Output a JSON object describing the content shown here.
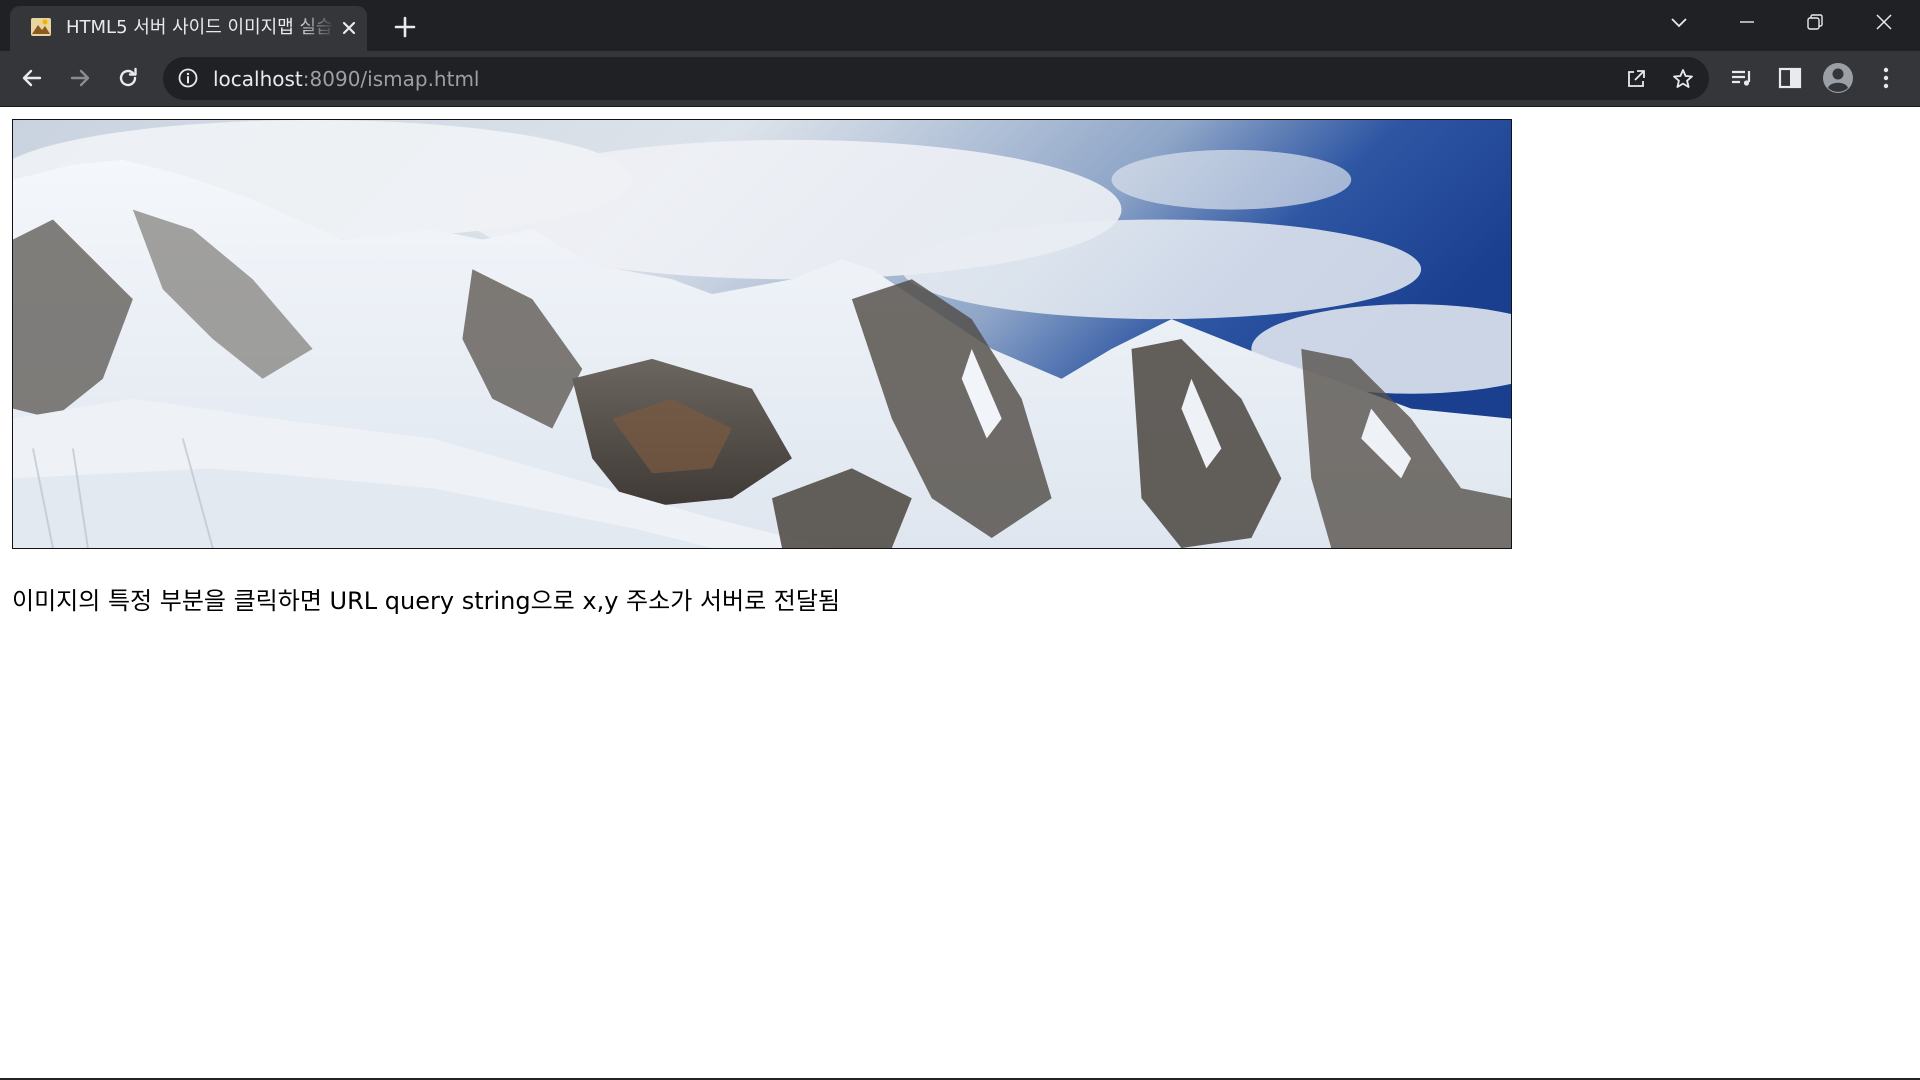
{
  "browser": {
    "tab": {
      "title": "HTML5 서버 사이드 이미지맵 실습",
      "favicon": "image-favicon"
    },
    "new_tab_icon": "plus-icon",
    "window_controls": [
      "tab-search-icon",
      "minimize-icon",
      "restore-icon",
      "close-icon"
    ],
    "toolbar": {
      "back_icon": "arrow-left-icon",
      "forward_icon": "arrow-right-icon",
      "reload_icon": "reload-icon",
      "url_host": "localhost",
      "url_rest": ":8090/ismap.html",
      "right_icons": [
        "share-icon",
        "star-icon",
        "media-queue-icon",
        "side-panel-icon",
        "profile-avatar-icon",
        "kebab-menu-icon"
      ]
    },
    "colors": {
      "tabstrip_bg": "#202124",
      "toolbar_bg": "#35363a",
      "omnibox_bg": "#202124",
      "icon_color": "#e8eaed"
    }
  },
  "page": {
    "image_description": "mountain panorama",
    "description_text": "이미지의 특정 부분을 클릭하면 URL query string으로 x,y 주소가 서버로 전달됨"
  }
}
